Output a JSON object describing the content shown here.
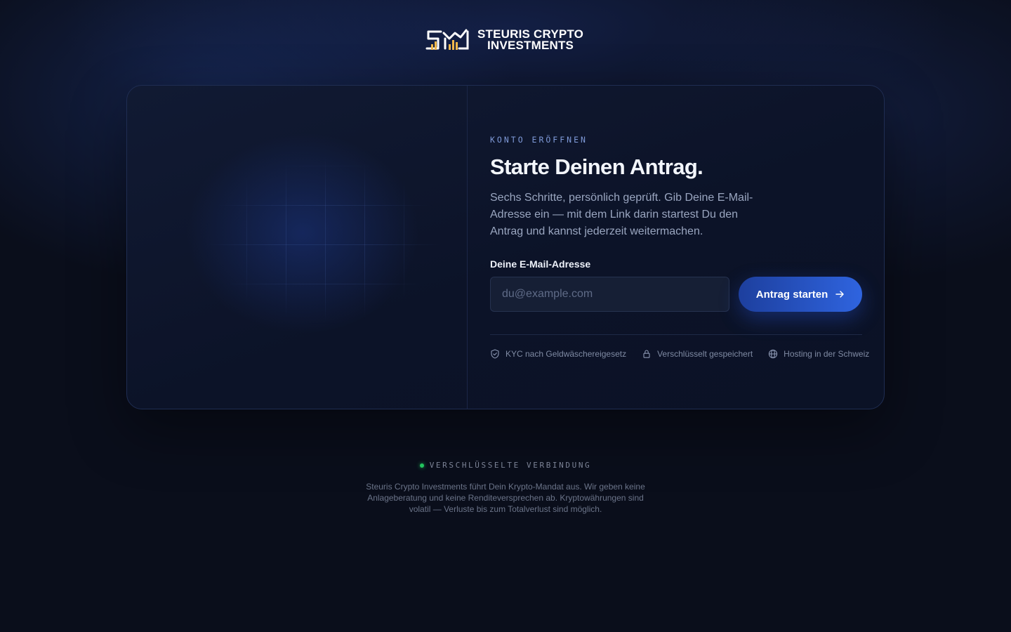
{
  "brand": {
    "name_line1": "STEURIS CRYPTO",
    "name_line2": "INVESTMENTS",
    "colors": {
      "gold": "#f2b84b",
      "white": "#ffffff"
    }
  },
  "form_card": {
    "eyebrow": "KONTO ERÖFFNEN",
    "headline": "Starte Deinen Antrag.",
    "lead": "Sechs Schritte, persönlich geprüft. Gib Deine E-Mail-Adresse ein — mit dem Link darin startest Du den Antrag und kannst jederzeit weitermachen.",
    "email_label": "Deine E-Mail-Adresse",
    "email_placeholder": "du@example.com",
    "email_value": "",
    "submit_label": "Antrag starten",
    "trust_items": [
      {
        "icon": "shield-check-icon",
        "label": "KYC nach Geldwäschereigesetz"
      },
      {
        "icon": "lock-icon",
        "label": "Verschlüsselt gespeichert"
      },
      {
        "icon": "globe-icon",
        "label": "Hosting in der Schweiz"
      }
    ]
  },
  "footer": {
    "status_label": "VERSCHLÜSSELTE VERBINDUNG",
    "status_color": "#22c55e",
    "disclaimer": "Steuris Crypto Investments führt Dein Krypto-Mandat aus. Wir geben keine Anlageberatung und keine Renditeversprechen ab. Kryptowährungen sind volatil — Verluste bis zum Totalverlust sind möglich."
  },
  "theme": {
    "accent": "#2f64df",
    "background": "#0a0e1b",
    "card_border": "#1f2d52"
  }
}
